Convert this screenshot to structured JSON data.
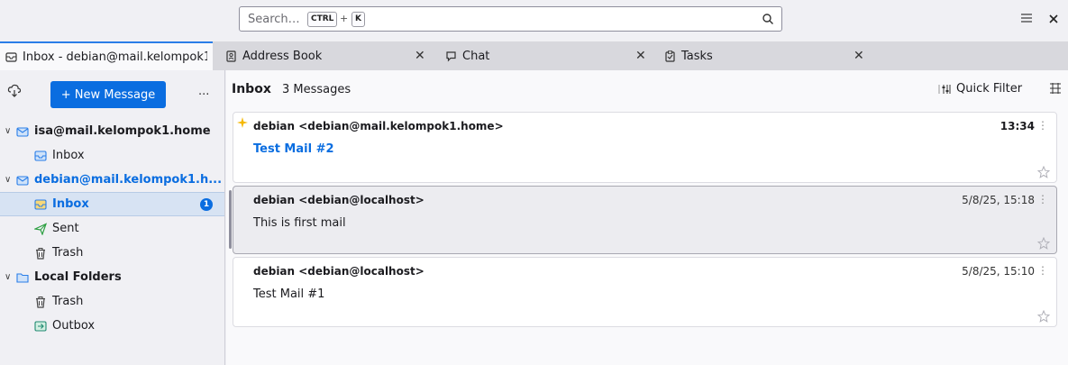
{
  "search": {
    "placeholder": "Search…",
    "shortcut_key1": "CTRL",
    "shortcut_plus": "+",
    "shortcut_key2": "K"
  },
  "tabs": [
    {
      "label": "Inbox - debian@mail.kelompok1",
      "icon": "mail-tab-icon"
    },
    {
      "label": "Address Book",
      "icon": "address-book-icon"
    },
    {
      "label": "Chat",
      "icon": "chat-icon"
    },
    {
      "label": "Tasks",
      "icon": "tasks-icon"
    }
  ],
  "sidebar": {
    "new_message_label": "+ New Message",
    "more_label": "...",
    "accounts": [
      {
        "name": "isa@mail.kelompok1.home",
        "folders": [
          "Inbox"
        ]
      },
      {
        "name": "debian@mail.kelompok1.h...",
        "folders": [
          "Inbox",
          "Sent",
          "Trash"
        ],
        "unread_badge": "1"
      },
      {
        "name": "Local Folders",
        "folders": [
          "Trash",
          "Outbox"
        ]
      }
    ]
  },
  "main": {
    "folder_title": "Inbox",
    "message_count": "3 Messages",
    "quick_filter_label": "Quick Filter",
    "messages": [
      {
        "sender": "debian <debian@mail.kelompok1.home>",
        "subject": "Test Mail #2",
        "date": "13:34",
        "unread": true
      },
      {
        "sender": "debian <debian@localhost>",
        "subject": "This is first mail",
        "date": "5/8/25, 15:18",
        "unread": false
      },
      {
        "sender": "debian <debian@localhost>",
        "subject": "Test Mail #1",
        "date": "5/8/25, 15:10",
        "unread": false
      }
    ]
  },
  "colors": {
    "accent": "#0a6de0",
    "unread_star": "#f5b800"
  }
}
